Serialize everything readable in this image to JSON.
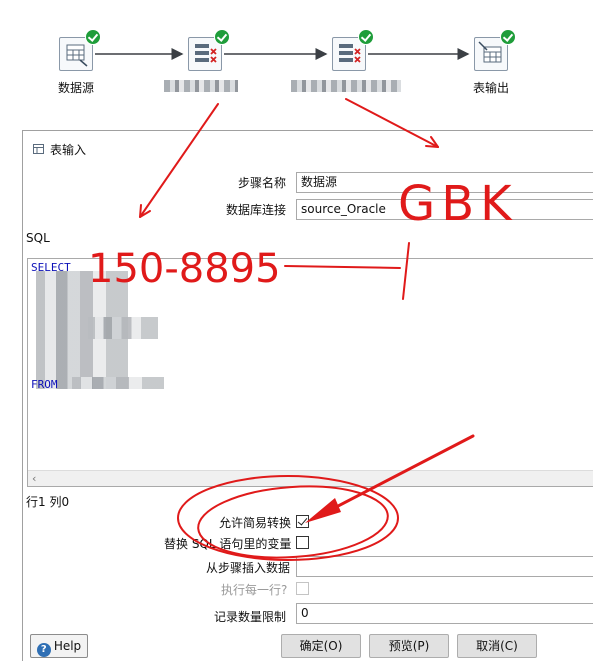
{
  "workflow": {
    "steps": [
      {
        "label": "数据源",
        "icon": "table-input-icon"
      },
      {
        "label": "",
        "icon": "select-values-icon"
      },
      {
        "label": "",
        "icon": "select-values-icon"
      },
      {
        "label": "表输出",
        "icon": "table-output-icon"
      }
    ]
  },
  "dialog": {
    "title": "表输入",
    "step_name_label": "步骤名称",
    "step_name_value": "数据源",
    "connection_label": "数据库连接",
    "connection_value": "source_Oracle",
    "sql_label": "SQL",
    "sql_lines": {
      "select": "SELECT",
      "from": "FROM"
    },
    "cursor_position": "行1 列0",
    "allow_lazy_conversion_label": "允许简易转换",
    "allow_lazy_conversion_checked": true,
    "replace_variables_label": "替换 SQL 语句里的变量",
    "replace_variables_checked": false,
    "insert_from_step_label": "从步骤插入数据",
    "execute_each_row_label": "执行每一行?",
    "limit_label": "记录数量限制",
    "limit_value": "0"
  },
  "buttons": {
    "help": "Help",
    "ok": "确定(O)",
    "preview": "预览(P)",
    "cancel": "取消(C)"
  },
  "annotations": {
    "handwriting_1": "GBK",
    "handwriting_2": "150-8895",
    "ink_color": "#e01a1a"
  }
}
